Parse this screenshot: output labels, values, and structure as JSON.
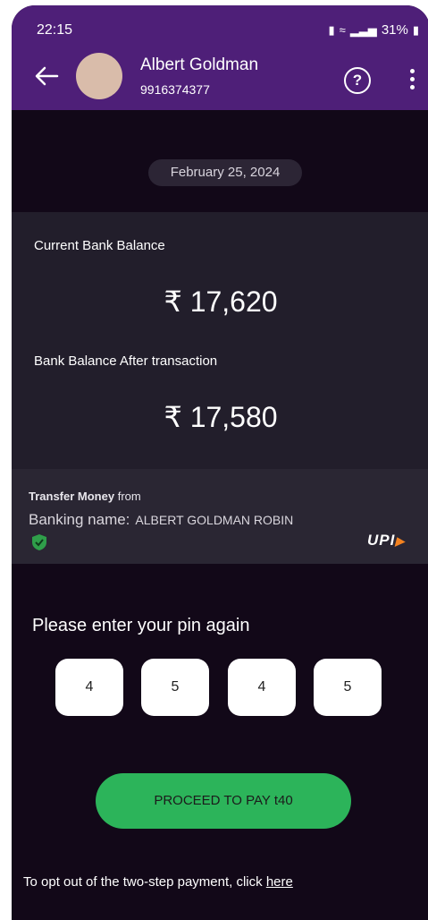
{
  "status_bar": {
    "time": "22:15",
    "battery": "31%"
  },
  "header": {
    "name": "Albert Goldman",
    "phone": "9916374377"
  },
  "date": "February 25, 2024",
  "balance": {
    "current_label": "Current Bank Balance",
    "current_value": "₹ 17,620",
    "after_label": "Bank Balance After transaction",
    "after_value": "₹ 17,580"
  },
  "transfer": {
    "title": "Transfer Money",
    "from": "from",
    "bank_label": "Banking name:",
    "bank_name": "ALBERT GOLDMAN ROBIN",
    "upi_logo": "UPI"
  },
  "pin": {
    "prompt": "Please enter your pin again",
    "digits": [
      "4",
      "5",
      "4",
      "5"
    ]
  },
  "pay_button": "PROCEED TO PAY t40",
  "optout": {
    "text": "To opt out of the two-step payment, click",
    "link": "here"
  },
  "colors": {
    "header": "#4e1f78",
    "background": "#120818",
    "card": "#221e2b",
    "accent": "#2cb45a"
  }
}
